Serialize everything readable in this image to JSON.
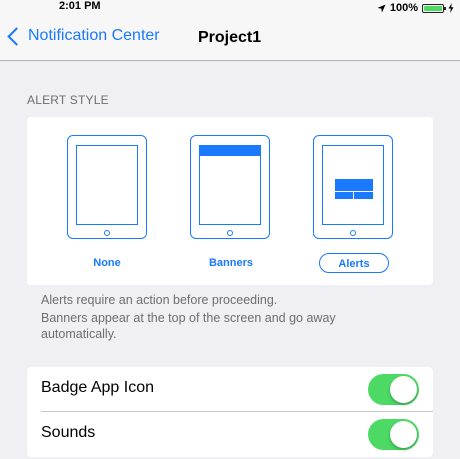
{
  "status_bar": {
    "time": "2:01 PM",
    "battery_percent": "100%",
    "icons": [
      "location-arrow-icon",
      "battery-icon",
      "charging-bolt-icon"
    ]
  },
  "nav": {
    "back_label": "Notification Center",
    "title": "Project1"
  },
  "alert_style": {
    "header": "ALERT STYLE",
    "options": [
      {
        "label": "None",
        "selected": false
      },
      {
        "label": "Banners",
        "selected": false
      },
      {
        "label": "Alerts",
        "selected": true
      }
    ],
    "note_line1": "Alerts require an action before proceeding.",
    "note_line2": "Banners appear at the top of the screen and go away automatically."
  },
  "settings": [
    {
      "label": "Badge App Icon",
      "on": true
    },
    {
      "label": "Sounds",
      "on": true
    }
  ],
  "colors": {
    "accent": "#1a7aff",
    "toggle_on": "#4cd964",
    "background": "#efeff4"
  }
}
